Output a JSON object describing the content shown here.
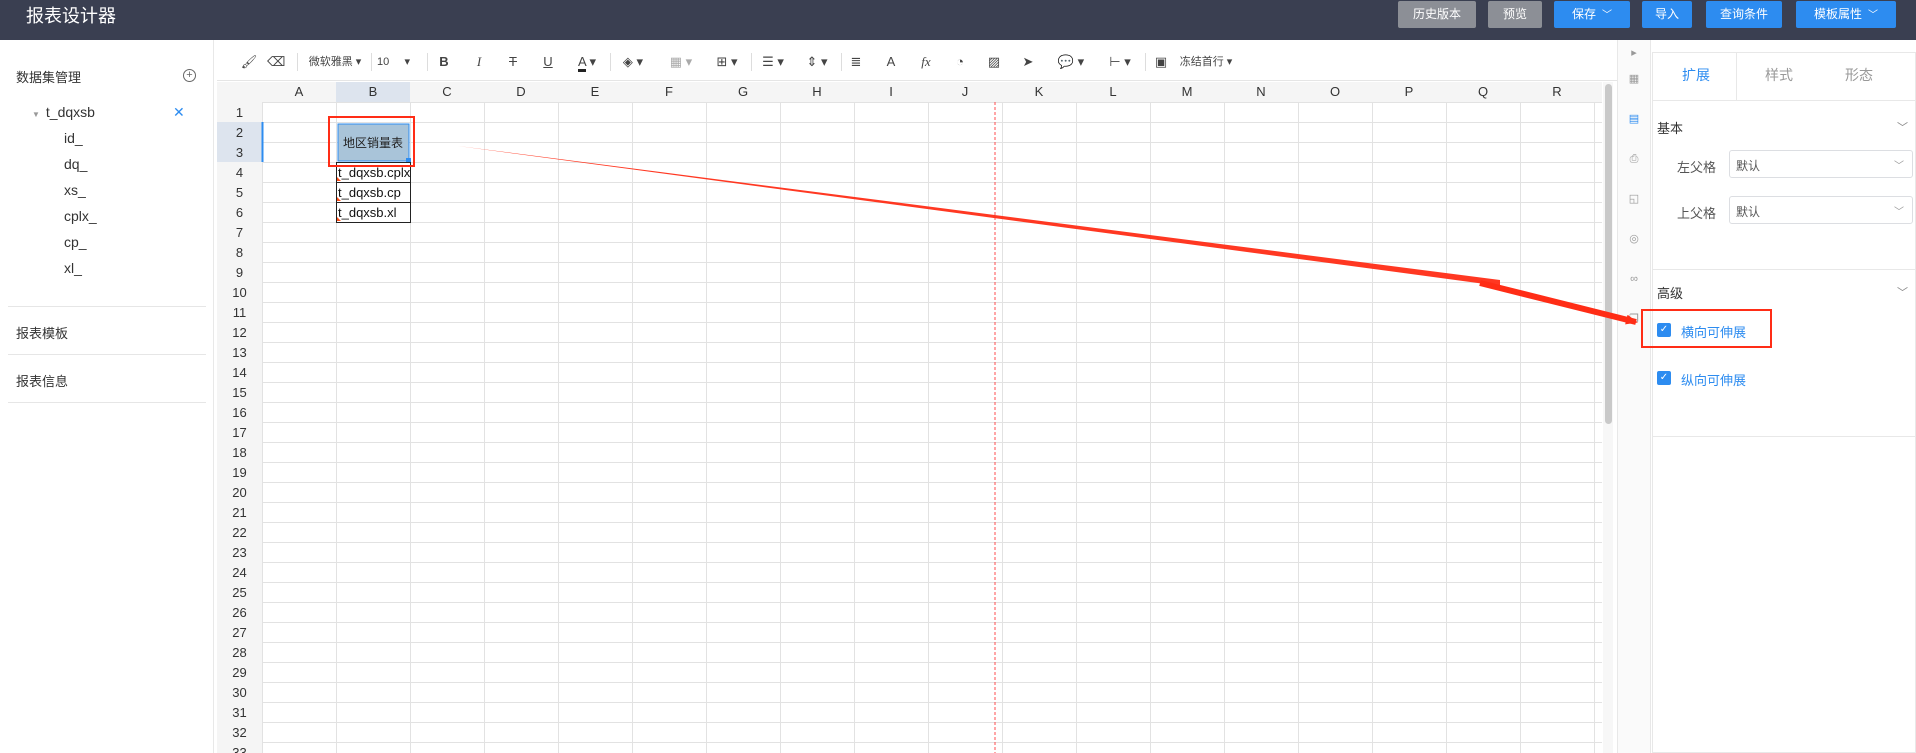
{
  "app": {
    "title": "报表设计器"
  },
  "header_buttons": [
    {
      "label": "历史版本",
      "style": "gray",
      "caret": false
    },
    {
      "label": "预览",
      "style": "gray",
      "caret": false
    },
    {
      "label": "保存",
      "style": "blue",
      "caret": true
    },
    {
      "label": "导入",
      "style": "blue",
      "caret": false
    },
    {
      "label": "查询条件",
      "style": "blue",
      "caret": false
    },
    {
      "label": "模板属性",
      "style": "blue",
      "caret": true
    }
  ],
  "left_panel": {
    "dataset_title": "数据集管理",
    "dataset_name": "t_dqxsb",
    "fields": [
      "id_",
      "dq_",
      "xs_",
      "cplx_",
      "cp_",
      "xl_"
    ],
    "template_title": "报表模板",
    "info_title": "报表信息"
  },
  "toolbar": {
    "font_name": "微软雅黑",
    "font_size": "10",
    "freeze_label": "冻结首行"
  },
  "grid": {
    "columns": [
      "A",
      "B",
      "C",
      "D",
      "E",
      "F",
      "G",
      "H",
      "I",
      "J",
      "K",
      "L",
      "M",
      "N",
      "O",
      "P",
      "Q",
      "R"
    ],
    "rows": [
      "1",
      "2",
      "3",
      "4",
      "5",
      "6",
      "7",
      "8",
      "9",
      "10",
      "11",
      "12",
      "13",
      "14",
      "15",
      "16",
      "17",
      "18",
      "19",
      "20",
      "21",
      "22",
      "23",
      "24",
      "25",
      "26",
      "27",
      "28",
      "29",
      "30",
      "31",
      "32",
      "33"
    ],
    "cells": {
      "title": "地区销量表",
      "row4": "t_dqxsb.cplx",
      "row5": "t_dqxsb.cp",
      "row6": "t_dqxsb.xl"
    }
  },
  "right_panel": {
    "tabs": [
      "扩展",
      "样式",
      "形态"
    ],
    "basic_title": "基本",
    "left_parent_label": "左父格",
    "left_parent_value": "默认",
    "top_parent_label": "上父格",
    "top_parent_value": "默认",
    "advanced_title": "高级",
    "horizontal_expand": "横向可伸展",
    "vertical_expand": "纵向可伸展"
  },
  "colors": {
    "header_bg": "#3a3f51",
    "accent": "#2d8cf0",
    "annotation": "#ff2d16"
  }
}
